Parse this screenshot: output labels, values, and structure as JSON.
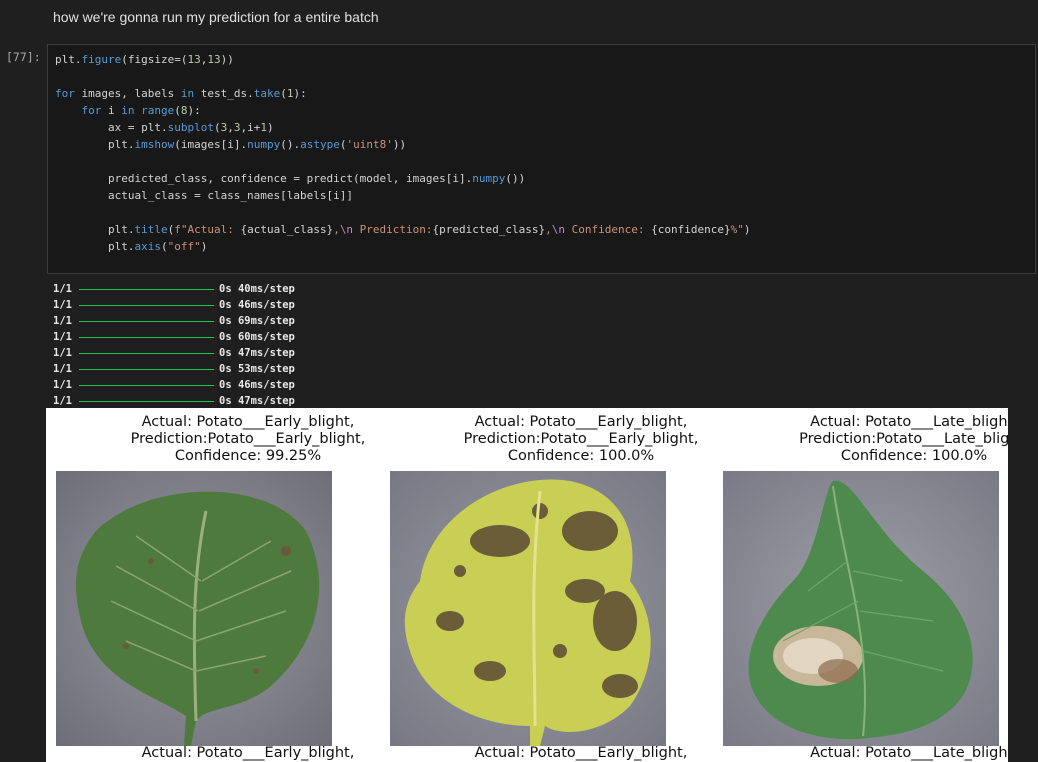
{
  "markdown": {
    "text": "how we're gonna run my prediction for a entire batch"
  },
  "cell": {
    "prompt": "[77]:"
  },
  "output": {
    "steps": [
      {
        "frac": "1/1",
        "time": "0s 40ms/step"
      },
      {
        "frac": "1/1",
        "time": "0s 46ms/step"
      },
      {
        "frac": "1/1",
        "time": "0s 69ms/step"
      },
      {
        "frac": "1/1",
        "time": "0s 60ms/step"
      },
      {
        "frac": "1/1",
        "time": "0s 47ms/step"
      },
      {
        "frac": "1/1",
        "time": "0s 53ms/step"
      },
      {
        "frac": "1/1",
        "time": "0s 46ms/step"
      },
      {
        "frac": "1/1",
        "time": "0s 47ms/step"
      }
    ],
    "progress_bar_color": "#1fbf5a"
  },
  "figure": {
    "subplots": [
      {
        "actual": "Actual: Potato___Early_blight,",
        "prediction": "Prediction:Potato___Early_blight,",
        "confidence": "Confidence: 99.25%"
      },
      {
        "actual": "Actual: Potato___Early_blight,",
        "prediction": "Prediction:Potato___Early_blight,",
        "confidence": "Confidence: 100.0%"
      },
      {
        "actual": "Actual: Potato___Late_blight,",
        "prediction": "Prediction:Potato___Late_blight,",
        "confidence": "Confidence: 100.0%"
      }
    ],
    "next_row": [
      {
        "actual": "Actual: Potato___Early_blight,"
      },
      {
        "actual": "Actual: Potato___Early_blight,"
      },
      {
        "actual": "Actual: Potato___Late_blight,"
      }
    ]
  }
}
